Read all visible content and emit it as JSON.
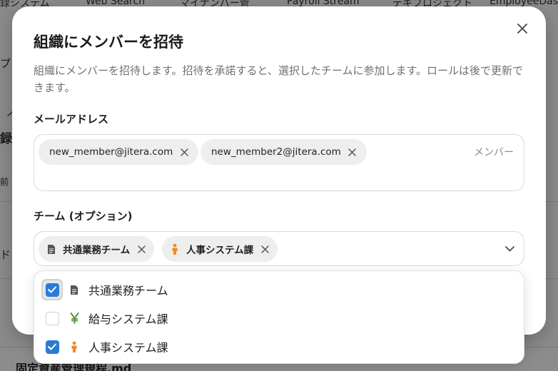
{
  "background": {
    "tabs": [
      "録システム",
      "Web Search",
      "マイナンバー管",
      "Payroll Stream",
      "テキプロジェクト",
      "EmployeeDas..."
    ],
    "fragments": [
      "プ",
      "ノ",
      "録",
      "前",
      "ド"
    ],
    "bottom_text": "固定資産管理規程.md"
  },
  "modal": {
    "title": "組織にメンバーを招待",
    "description": "組織にメンバーを招待します。招待を承諾すると、選択したチームに参加します。ロールは後で更新できます。",
    "email_label": "メールアドレス",
    "email_chips": [
      "new_member@jitera.com",
      "new_member2@jitera.com"
    ],
    "email_placeholder": "メンバー",
    "team_label": "チーム (オプション)",
    "team_chips": [
      {
        "label": "共通業務チーム",
        "icon": "document-icon"
      },
      {
        "label": "人事システム課",
        "icon": "person-icon"
      }
    ]
  },
  "dropdown": {
    "options": [
      {
        "label": "共通業務チーム",
        "checked": true,
        "icon": "document-icon"
      },
      {
        "label": "給与システム課",
        "checked": false,
        "icon": "yen-icon"
      },
      {
        "label": "人事システム課",
        "checked": true,
        "icon": "person-icon"
      }
    ]
  },
  "colors": {
    "accent": "#2a7bd6",
    "yen": "#5a9a3a",
    "person": "#f08a24",
    "doc": "#555555"
  }
}
